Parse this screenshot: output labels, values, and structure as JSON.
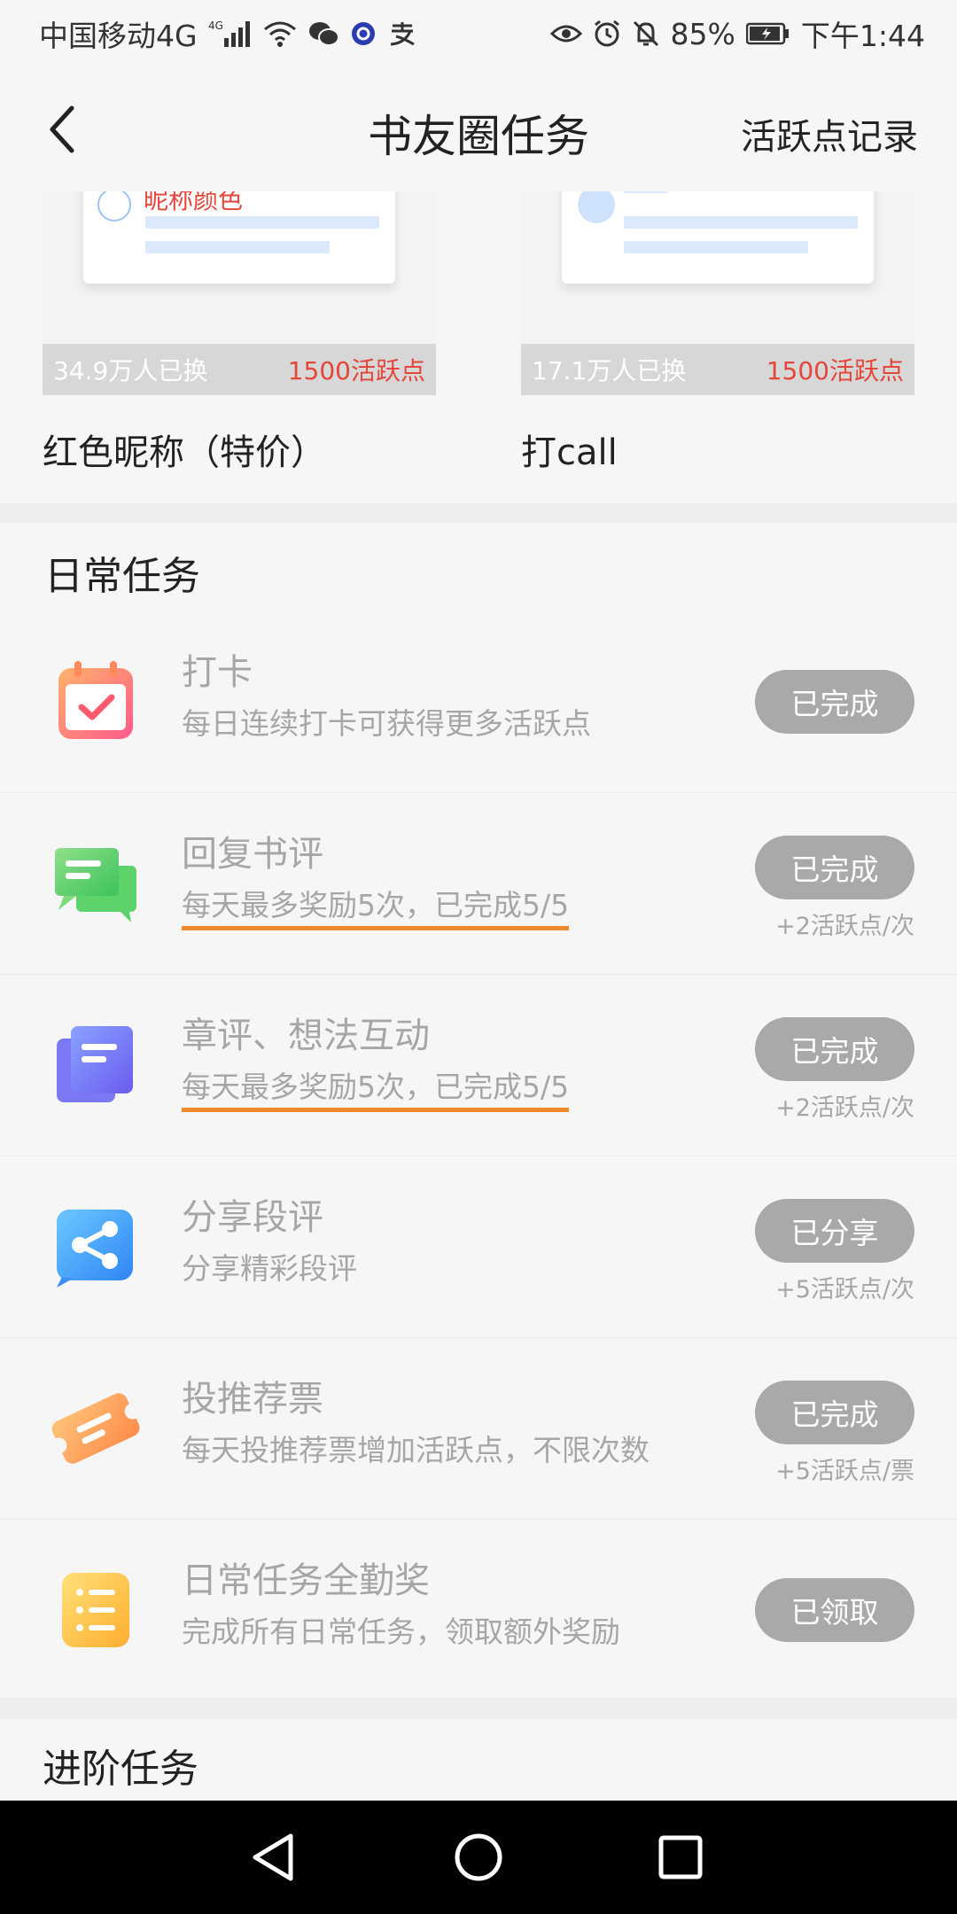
{
  "status_bar": {
    "carrier": "中国移动4G",
    "network_tag": "4G",
    "battery": "85%",
    "time": "下午1:44",
    "icons": [
      "signal-icon",
      "wifi-icon",
      "wechat-icon",
      "app-icon",
      "alipay-icon",
      "eye-icon",
      "alarm-icon",
      "mute-icon",
      "battery-icon"
    ]
  },
  "nav": {
    "title": "书友圈任务",
    "right_link": "活跃点记录"
  },
  "rewards": [
    {
      "name": "红色昵称（特价）",
      "count": "34.9万人已换",
      "price": "1500活跃点",
      "preview_nick": "昵称颜色"
    },
    {
      "name": "打call",
      "count": "17.1万人已换",
      "price": "1500活跃点"
    }
  ],
  "daily": {
    "title": "日常任务",
    "tasks": [
      {
        "name": "打卡",
        "desc": "每日连续打卡可获得更多活跃点",
        "button": "已完成",
        "points": "",
        "icon": "calendar-check-icon"
      },
      {
        "name": "回复书评",
        "desc": "每天最多奖励5次，已完成5/5",
        "button": "已完成",
        "points": "+2活跃点/次",
        "icon": "chat-bubbles-icon"
      },
      {
        "name": "章评、想法互动",
        "desc": "每天最多奖励5次，已完成5/5",
        "button": "已完成",
        "points": "+2活跃点/次",
        "icon": "notes-icon"
      },
      {
        "name": "分享段评",
        "desc": "分享精彩段评",
        "button": "已分享",
        "points": "+5活跃点/次",
        "icon": "share-icon"
      },
      {
        "name": "投推荐票",
        "desc": "每天投推荐票增加活跃点，不限次数",
        "button": "已完成",
        "points": "+5活跃点/票",
        "icon": "ticket-icon"
      },
      {
        "name": "日常任务全勤奖",
        "desc": "完成所有日常任务，领取额外奖励",
        "button": "已领取",
        "points": "",
        "icon": "list-icon"
      }
    ]
  },
  "advanced": {
    "title": "进阶任务"
  },
  "colors": {
    "accent_red": "#e4463a",
    "underline_orange": "#ef8a2c",
    "button_gray": "#a9a9a9",
    "text_gray": "#a6a6a6",
    "background": "#f6f6f6"
  }
}
